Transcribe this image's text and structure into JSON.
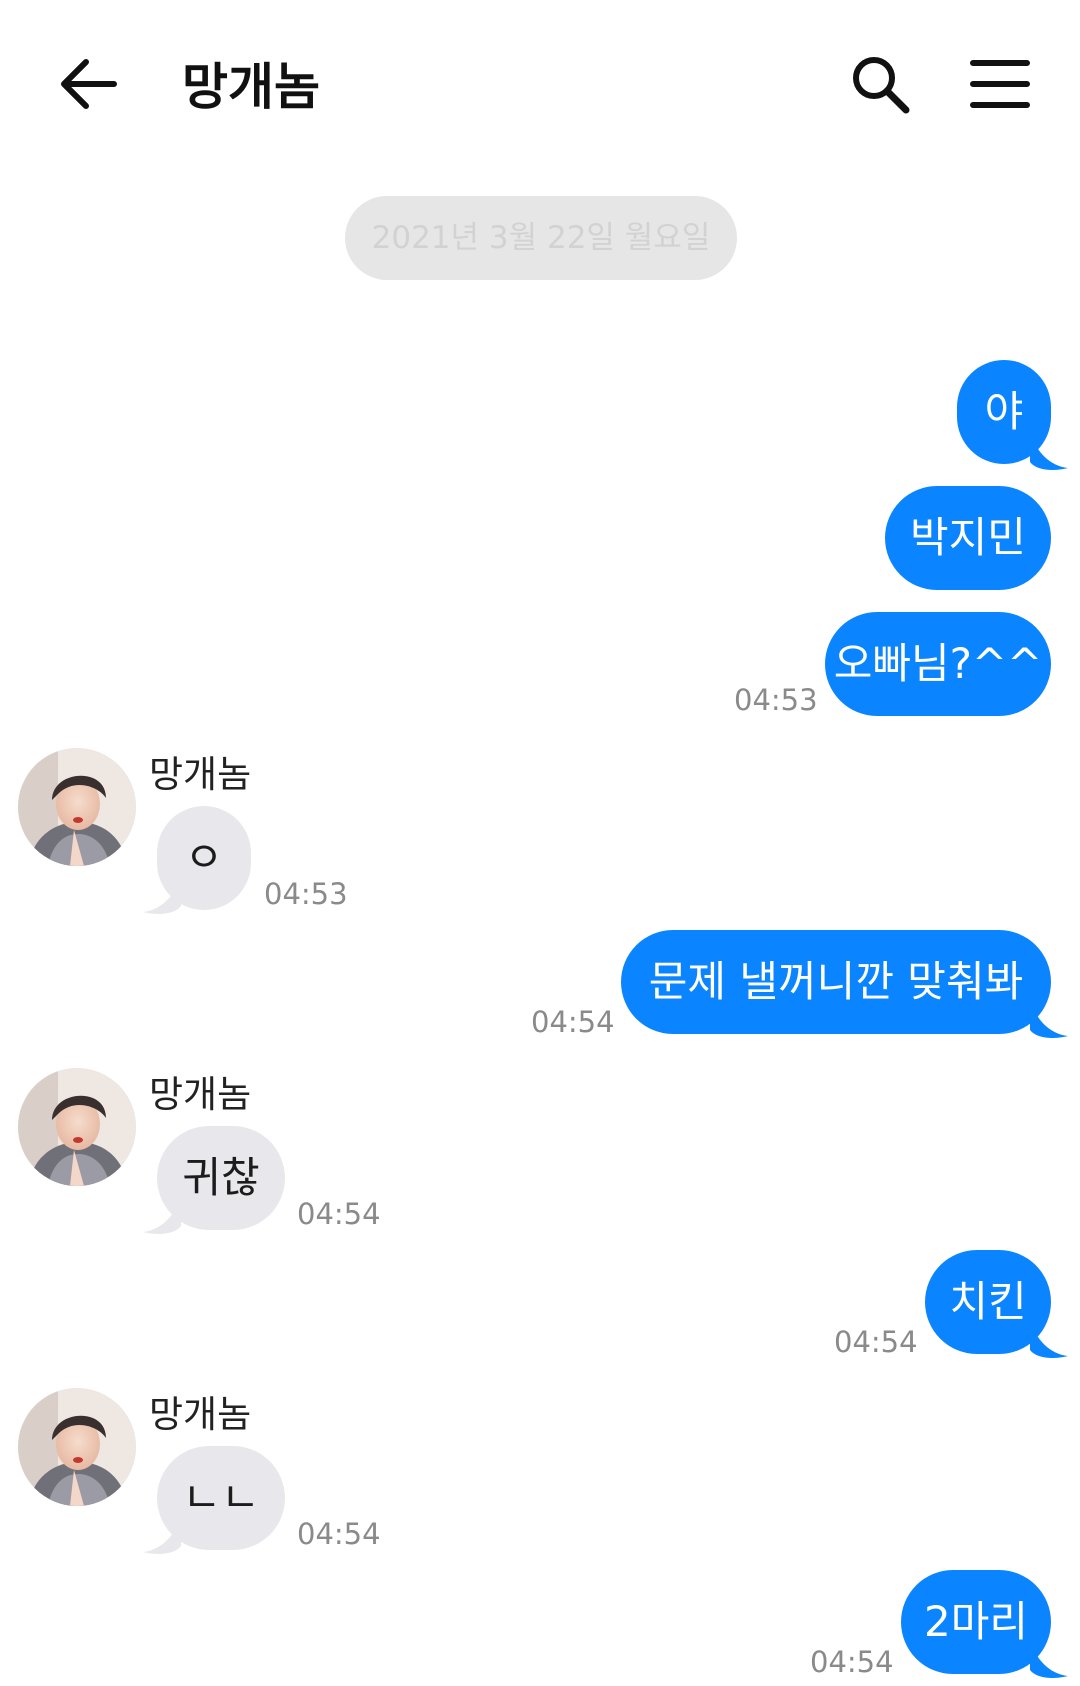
{
  "header": {
    "title": "망개놈",
    "back_icon": "arrow-left-icon",
    "search_icon": "search-icon",
    "menu_icon": "hamburger-menu-icon"
  },
  "date_divider": "2021년 3월 22일 월요일",
  "contact_name": "망개놈",
  "colors": {
    "my_bubble": "#0b84ff",
    "their_bubble": "#e8e8ec",
    "timestamp": "#8a8a8a"
  },
  "messages": [
    {
      "from": "me",
      "text": "야"
    },
    {
      "from": "me",
      "text": "박지민"
    },
    {
      "from": "me",
      "text": "오빠님?^^",
      "time": "04:53"
    },
    {
      "from": "them",
      "name": "망개놈",
      "text": "ㅇ",
      "time": "04:53"
    },
    {
      "from": "me",
      "text": "문제 낼꺼니깐 맞춰봐",
      "time": "04:54"
    },
    {
      "from": "them",
      "name": "망개놈",
      "text": "귀찮",
      "time": "04:54"
    },
    {
      "from": "me",
      "text": "치킨",
      "time": "04:54"
    },
    {
      "from": "them",
      "name": "망개놈",
      "text": "ㄴㄴ",
      "time": "04:54"
    },
    {
      "from": "me",
      "text": "2마리",
      "time": "04:54"
    }
  ]
}
